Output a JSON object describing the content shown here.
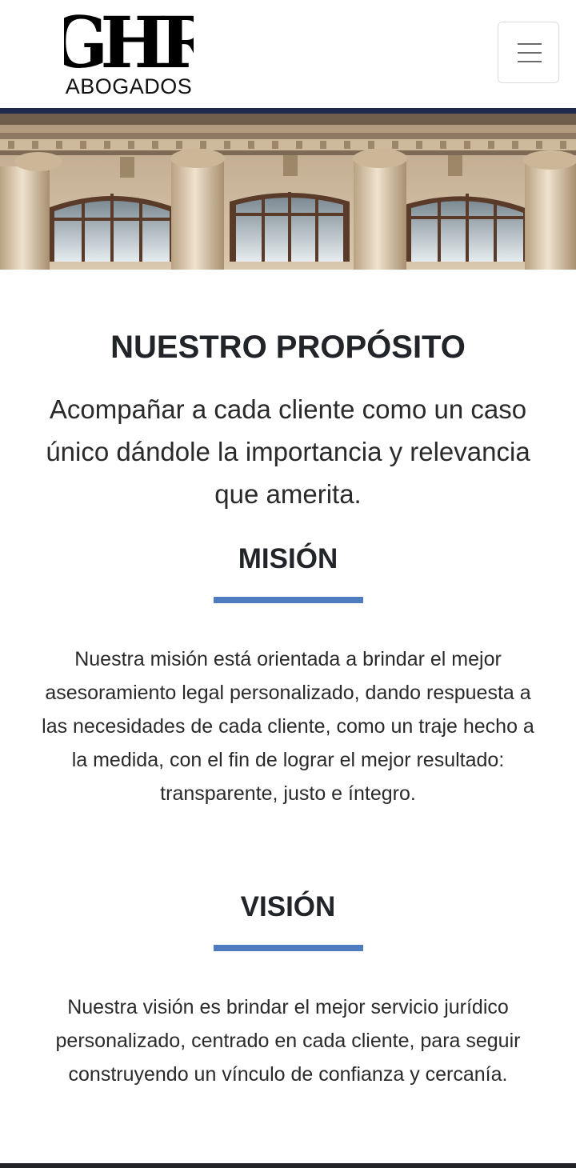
{
  "header": {
    "logo_mark": "GHR",
    "logo_word": "ABOGADOS",
    "menu_icon": "hamburger-icon"
  },
  "hero": {
    "image": "neoclassical-building-facade"
  },
  "purpose": {
    "title": "NUESTRO PROPÓSITO",
    "text": "Acompañar a cada cliente como un caso único dándole la importancia y relevancia que amerita."
  },
  "mission": {
    "title": "MISIÓN",
    "text": "Nuestra misión está orientada a brindar el mejor asesoramiento legal personalizado, dando respuesta a las necesidades de cada cliente, como un traje hecho a la medida, con el fin de lograr el mejor resultado: transparente, justo e íntegro."
  },
  "vision": {
    "title": "VISIÓN",
    "text": "Nuestra visión es brindar el mejor servicio jurídico personalizado, centrado en cada cliente, para seguir construyendo un vínculo de confianza y cercanía."
  },
  "colors": {
    "navy": "#1f2a4f",
    "accent_blue": "#4f7bbf",
    "text": "#212529"
  }
}
